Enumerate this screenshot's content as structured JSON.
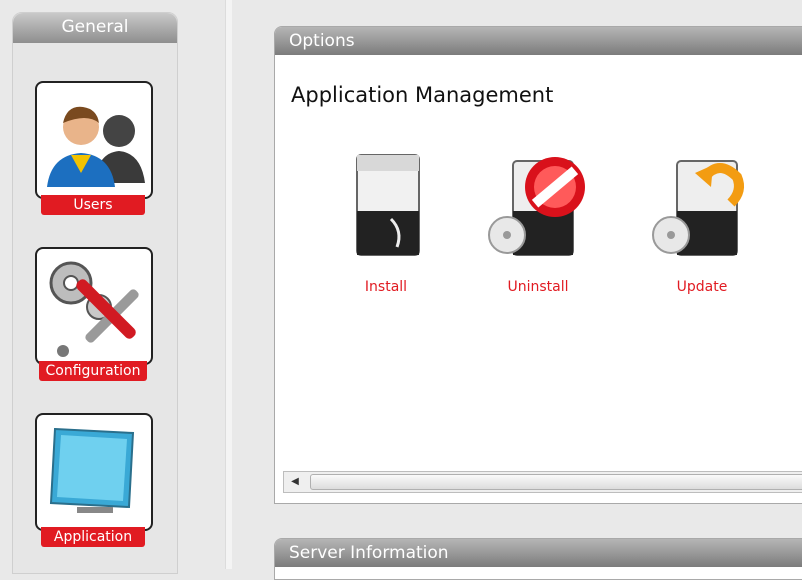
{
  "sidebar": {
    "title": "General",
    "items": [
      {
        "label": "Users",
        "icon": "users-icon"
      },
      {
        "label": "Configuration",
        "icon": "tools-icon"
      },
      {
        "label": "Application",
        "icon": "monitor-icon"
      }
    ]
  },
  "options_panel": {
    "title": "Options",
    "section_title": "Application Management",
    "apps": [
      {
        "label": "Install",
        "icon": "install-icon"
      },
      {
        "label": "Uninstall",
        "icon": "uninstall-icon"
      },
      {
        "label": "Update",
        "icon": "update-icon"
      }
    ]
  },
  "server_panel": {
    "title": "Server Information"
  },
  "colors": {
    "accent_red": "#e11b22",
    "header_gray": "#8e8e8e"
  }
}
